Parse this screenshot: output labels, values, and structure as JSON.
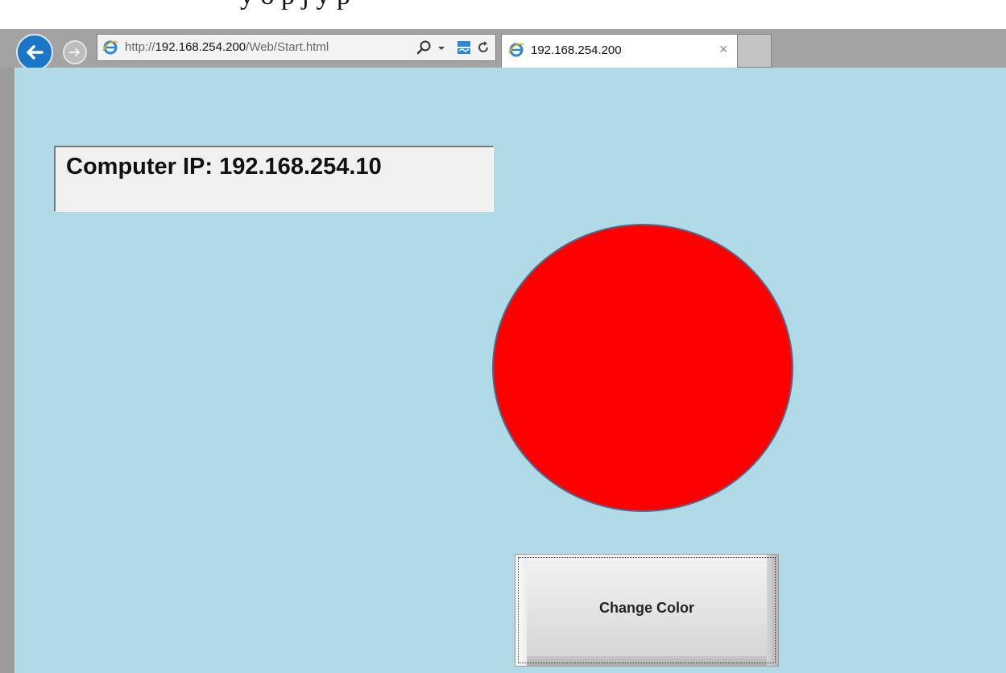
{
  "page_caption": "y  o p j  y  p",
  "browser": {
    "url_prefix": "http://",
    "url_host": "192.168.254.200",
    "url_path": "/Web/Start.html",
    "tab_title": "192.168.254.200",
    "tab_close": "×"
  },
  "app": {
    "ip_label": "Computer IP: 192.168.254.10",
    "indicator_color": "#ff0000",
    "button_label": "Change Color"
  },
  "colors": {
    "page_background": "#b0dbe6",
    "accent": "#1b76c8"
  },
  "icons": [
    "back-icon",
    "forward-icon",
    "ie-icon",
    "search-icon",
    "dropdown-icon",
    "compatibility-icon",
    "refresh-icon",
    "close-icon"
  ]
}
